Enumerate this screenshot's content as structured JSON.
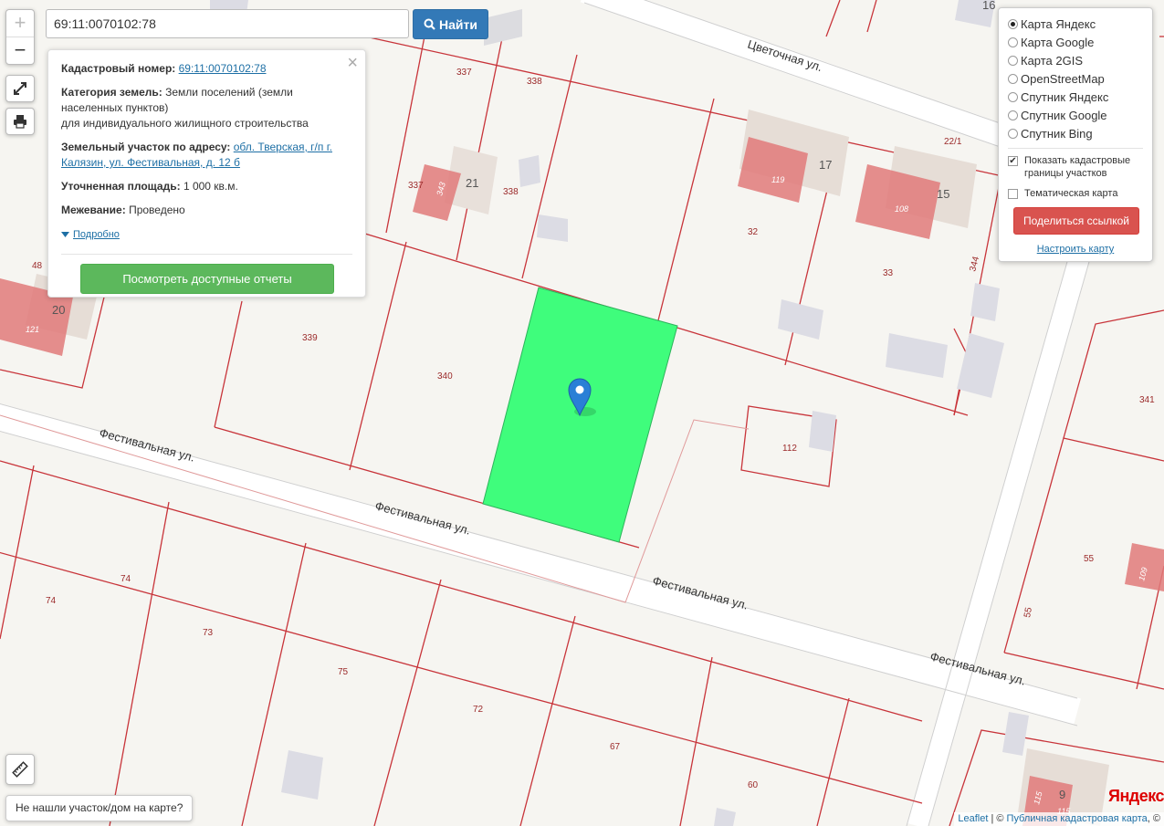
{
  "search": {
    "value": "69:11:0070102:78",
    "button_label": "Найти"
  },
  "zoom": {
    "in_label": "+",
    "out_label": "−"
  },
  "info_panel": {
    "cadastral_label": "Кадастровый номер:",
    "cadastral_value": "69:11:0070102:78",
    "category_label": "Категория земель:",
    "category_value": "Земли поселений (земли населенных пунктов)",
    "category_value2": "для индивидуального жилищного строительства",
    "address_label": "Земельный участок по адресу:",
    "address_value": "обл. Тверская, г/п г. Калязин, ул. Фестивальная, д. 12 б",
    "area_label": "Уточненная площадь:",
    "area_value": "1 000 кв.м.",
    "survey_label": "Межевание:",
    "survey_value": "Проведено",
    "more_label": "Подробно",
    "reports_button": "Посмотреть доступные отчеты",
    "close_label": "×"
  },
  "layers": {
    "options": [
      {
        "label": "Карта Яндекс",
        "selected": true
      },
      {
        "label": "Карта Google",
        "selected": false
      },
      {
        "label": "Карта 2GIS",
        "selected": false
      },
      {
        "label": "OpenStreetMap",
        "selected": false
      },
      {
        "label": "Спутник Яндекс",
        "selected": false
      },
      {
        "label": "Спутник Google",
        "selected": false
      },
      {
        "label": "Спутник Bing",
        "selected": false
      }
    ],
    "show_borders_label": "Показать кадастровые границы участков",
    "show_borders_checked": true,
    "thematic_label": "Тематическая карта",
    "thematic_checked": false,
    "share_button": "Поделиться ссылкой",
    "configure_link": "Настроить карту"
  },
  "not_found_button": "Не нашли участок/дом на карте?",
  "attribution": {
    "leaflet": "Leaflet",
    "separator": " | © ",
    "pkk": "Публичная кадастровая карта",
    "suffix": ", ©"
  },
  "yandex_logo": "Яндекс",
  "map": {
    "streets": [
      "Цветочная ул.",
      "Фестивальная ул.",
      "Фестивальная ул.",
      "Фестивальная ул.",
      "Фестивальная ул."
    ],
    "house_numbers": [
      "21",
      "17",
      "15",
      "20",
      "16",
      "9",
      "22/1"
    ],
    "parcel_numbers": [
      "337",
      "338",
      "337",
      "338",
      "339",
      "340",
      "32",
      "33",
      "344",
      "112",
      "341",
      "55",
      "55",
      "74",
      "74",
      "73",
      "75",
      "72",
      "67",
      "60",
      "48"
    ],
    "building_numbers": [
      "343",
      "119",
      "108",
      "121",
      "109",
      "115",
      "115"
    ]
  },
  "colors": {
    "selected_parcel": "#3ffd7c",
    "parcel_border": "#c8343a",
    "building_red": "#e07a7a",
    "marker": "#2a7fd6"
  }
}
